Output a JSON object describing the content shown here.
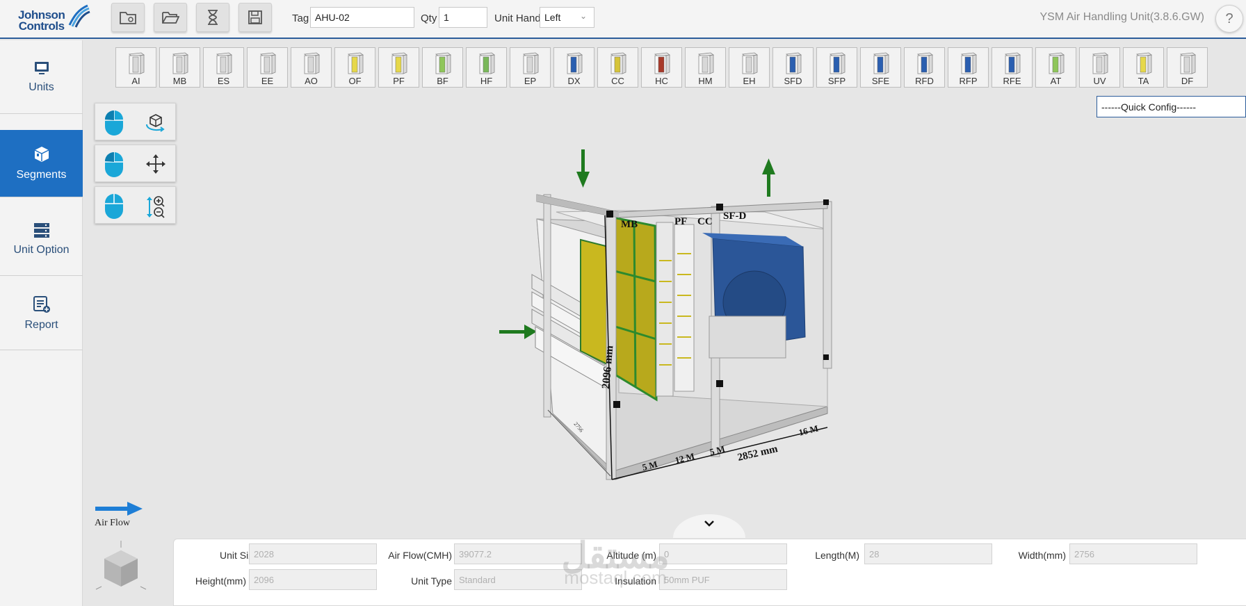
{
  "brand": {
    "line1": "Johnson",
    "line2": "Controls"
  },
  "toolbar": {
    "buttons": [
      "new-project",
      "open-folder",
      "history",
      "save"
    ],
    "tag_label": "Tag",
    "tag_value": "AHU-02",
    "qty_label": "Qty",
    "qty_value": "1",
    "unit_hand_label": "Unit Hand",
    "unit_hand_value": "Left",
    "app_title": "YSM Air Handling Unit(3.8.6.GW)",
    "help_label": "?"
  },
  "sidebar": {
    "items": [
      {
        "label": "Units",
        "icon": "monitor-icon",
        "active": false
      },
      {
        "label": "Segments",
        "icon": "cube-segment-icon",
        "active": true
      },
      {
        "label": "Unit Option",
        "icon": "server-rack-icon",
        "active": false
      },
      {
        "label": "Report",
        "icon": "report-add-icon",
        "active": false
      }
    ]
  },
  "segments": [
    {
      "code": "AI",
      "color": "#d8d8d8"
    },
    {
      "code": "MB",
      "color": "#d8d8d8"
    },
    {
      "code": "ES",
      "color": "#d8d8d8"
    },
    {
      "code": "EE",
      "color": "#d8d8d8"
    },
    {
      "code": "AO",
      "color": "#d8d8d8"
    },
    {
      "code": "OF",
      "color": "#e6d84a"
    },
    {
      "code": "PF",
      "color": "#e6d84a"
    },
    {
      "code": "BF",
      "color": "#8fc65a"
    },
    {
      "code": "HF",
      "color": "#7ab85a"
    },
    {
      "code": "EP",
      "color": "#d8d8d8"
    },
    {
      "code": "DX",
      "color": "#2b5fb0"
    },
    {
      "code": "CC",
      "color": "#d6c43a"
    },
    {
      "code": "HC",
      "color": "#a83a2a"
    },
    {
      "code": "HM",
      "color": "#d8d8d8"
    },
    {
      "code": "EH",
      "color": "#d8d8d8"
    },
    {
      "code": "SFD",
      "color": "#2b5fb0"
    },
    {
      "code": "SFP",
      "color": "#2b5fb0"
    },
    {
      "code": "SFE",
      "color": "#2b5fb0"
    },
    {
      "code": "RFD",
      "color": "#2b5fb0"
    },
    {
      "code": "RFP",
      "color": "#2b5fb0"
    },
    {
      "code": "RFE",
      "color": "#2b5fb0"
    },
    {
      "code": "AT",
      "color": "#8fc65a"
    },
    {
      "code": "UV",
      "color": "#d8d8d8"
    },
    {
      "code": "TA",
      "color": "#e6d84a"
    },
    {
      "code": "DF",
      "color": "#d8d8d8"
    }
  ],
  "quick_config": "------Quick Config------",
  "mouse_controls": [
    {
      "action": "rotate",
      "icon": "rotate-3d-icon"
    },
    {
      "action": "pan",
      "icon": "move-arrows-icon"
    },
    {
      "action": "zoom",
      "icon": "zoom-icon"
    }
  ],
  "model": {
    "labels": {
      "mb": "MB",
      "pf": "PF",
      "cc": "CC",
      "sfd": "SF-D"
    },
    "height_dim": "2096 mm",
    "length_dim": "2852 mm",
    "width_dim": "2756",
    "module_dims": [
      "5 M",
      "12 M",
      "5 M",
      "16 M"
    ]
  },
  "airflow_label": "Air Flow",
  "info": {
    "unit_size_label": "Unit Size",
    "unit_size": "2028",
    "air_flow_label": "Air Flow(CMH)",
    "air_flow": "39077.2",
    "altitude_label": "Altitude (m)",
    "altitude": "0",
    "length_label": "Length(M)",
    "length": "28",
    "width_label": "Width(mm)",
    "width": "2756",
    "height_label": "Height(mm)",
    "height": "2096",
    "unit_type_label": "Unit Type",
    "unit_type": "Standard",
    "insulation_label": "Insulation",
    "insulation": "50mm PUF"
  },
  "watermark": {
    "line1": "مستقل",
    "line2": "mostaql.com"
  }
}
